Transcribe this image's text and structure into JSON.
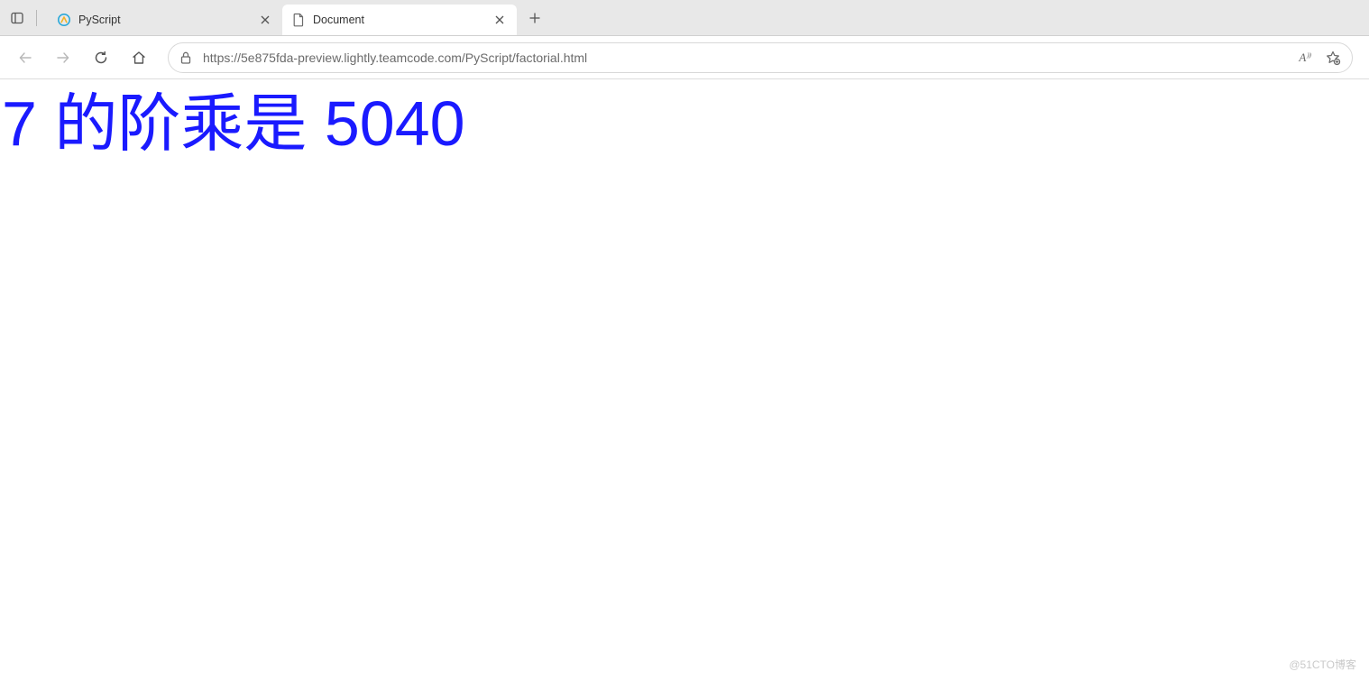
{
  "titlebar": {
    "tabs": [
      {
        "title": "PyScript",
        "active": false,
        "favicon": "pyscript"
      },
      {
        "title": "Document",
        "active": true,
        "favicon": "document"
      }
    ]
  },
  "toolbar": {
    "url": "https://5e875fda-preview.lightly.teamcode.com/PyScript/factorial.html",
    "read_aloud_label": "A⁾⁾"
  },
  "page": {
    "headline": "7 的阶乘是 5040"
  },
  "watermark": "@51CTO博客"
}
